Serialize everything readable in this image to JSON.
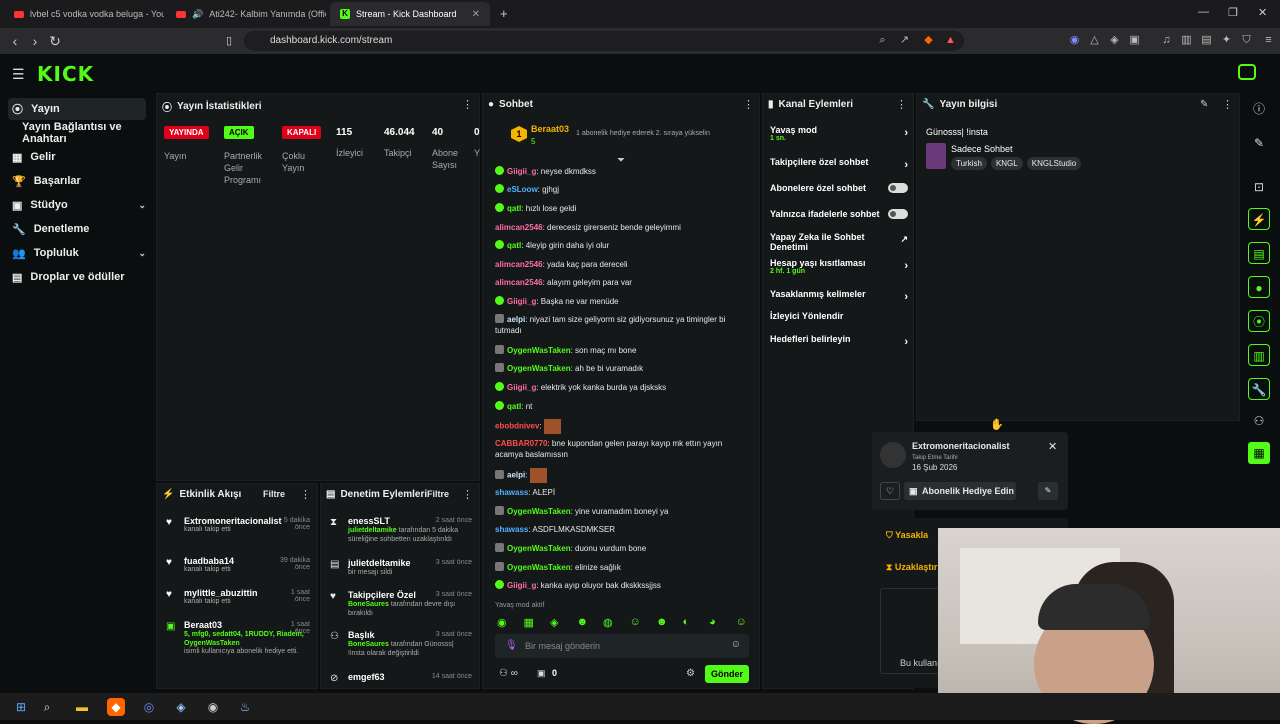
{
  "browser": {
    "tabs": [
      {
        "label": "lvbel c5 vodka vodka beluga - YouTu"
      },
      {
        "label": "Ati242- Kalbim Yanımda (Official"
      },
      {
        "label": "Stream - Kick Dashboard"
      }
    ],
    "url": "dashboard.kick.com/stream"
  },
  "sidebar": {
    "items": [
      {
        "label": "Yayın"
      },
      {
        "label": "Yayın Bağlantısı ve Anahtarı"
      },
      {
        "label": "Gelir"
      },
      {
        "label": "Başarılar"
      },
      {
        "label": "Stüdyo"
      },
      {
        "label": "Denetleme"
      },
      {
        "label": "Topluluk"
      },
      {
        "label": "Droplar ve ödüller"
      }
    ]
  },
  "stats": {
    "title": "Yayın İstatistikleri",
    "badges": [
      "YAYINDA",
      "AÇIK",
      "KAPALI"
    ],
    "badge_labels": [
      "Yayın",
      "Partnerlik Gelir Programı",
      "Çoklu Yayın"
    ],
    "numbers": [
      {
        "value": "115",
        "label": "İzleyici"
      },
      {
        "value": "46.044",
        "label": "Takipçi"
      },
      {
        "value": "40",
        "label": "Abone Sayısı"
      },
      {
        "value": "0",
        "label": "Y"
      }
    ]
  },
  "chat": {
    "title": "Sohbet",
    "pinned_user": "Beraat03",
    "pinned_count": "5",
    "pinned_rank": "1",
    "pinned_text": "1 abonelik hediye ederek 2. sıraya yükselin",
    "messages": [
      {
        "user": "Giigii_g",
        "text": "neyse dkmdkss"
      },
      {
        "user": "eSLoow",
        "text": "gjhgj"
      },
      {
        "user": "qatl",
        "text": "hızlı lose geldi"
      },
      {
        "user": "alimcan2546",
        "text": "derecesiz girerseniz bende geleyimmi"
      },
      {
        "user": "qatl",
        "text": "4leyip girin daha iyi olur"
      },
      {
        "user": "alimcan2546",
        "text": "yada kaç para dereceli"
      },
      {
        "user": "alimcan2546",
        "text": "alayım geleyim para var"
      },
      {
        "user": "Giigii_g",
        "text": "Başka ne var menüde"
      },
      {
        "user": "aelpi",
        "text": "niyazi tam size geliyorm siz gidiyorsunuz ya timingler bi tutmadı"
      },
      {
        "user": "OygenWasTaken",
        "text": "son maç mı bone"
      },
      {
        "user": "OygenWasTaken",
        "text": "ah be bi vuramadık"
      },
      {
        "user": "Giigii_g",
        "text": "elektrik yok kanka burda ya djsksks"
      },
      {
        "user": "qatl",
        "text": "nt"
      },
      {
        "user": "ebobdnivev",
        "text": ""
      },
      {
        "user": "CABBAR0770",
        "text": "bne kupondan gelen parayı kayıp mk ettın yayın acamya baslamıssın"
      },
      {
        "user": "aelpi",
        "text": ""
      },
      {
        "user": "shawass",
        "text": "ALEPİ"
      },
      {
        "user": "OygenWasTaken",
        "text": "yine vuramadım boneyi ya"
      },
      {
        "user": "shawass",
        "text": "ASDFLMKASDMKSER"
      },
      {
        "user": "OygenWasTaken",
        "text": "duonu vurdum bone"
      },
      {
        "user": "OygenWasTaken",
        "text": "elinize sağlık"
      },
      {
        "user": "Giigii_g",
        "text": "kanka ayıp oluyor bak dkskkssjjss"
      }
    ],
    "slow_mode": "Yavaş mod aktif",
    "input_placeholder": "Bir mesaj gönderin",
    "points": "0",
    "send": "Gönder"
  },
  "channel_actions": {
    "title": "Kanal Eylemleri",
    "items": [
      {
        "label": "Yavaş mod",
        "sub": "1 sn."
      },
      {
        "label": "Takipçilere özel sohbet",
        "sub": ""
      },
      {
        "label": "Abonelere özel sohbet",
        "sub": ""
      },
      {
        "label": "Yalnızca ifadelerle sohbet",
        "sub": ""
      },
      {
        "label": "Yapay Zeka ile Sohbet Denetimi",
        "sub": ""
      },
      {
        "label": "Hesap yaşı kısıtlaması",
        "sub": "2 hf. 1 gün"
      },
      {
        "label": "Yasaklanmış kelimeler",
        "sub": ""
      },
      {
        "label": "İzleyici Yönlendir",
        "sub": ""
      },
      {
        "label": "Hedefleri belirleyin",
        "sub": ""
      }
    ]
  },
  "stream_info": {
    "title": "Yayın bilgisi",
    "stream_title": "Günosss| !insta",
    "category": "Sadece Sohbet",
    "tags": [
      "Turkish",
      "KNGL",
      "KNGLStudio"
    ]
  },
  "activity": {
    "title": "Etkinlik Akışı",
    "filter": "Filtre",
    "items": [
      {
        "name": "Extromoneritacionalist",
        "time": "5 dakika önce",
        "sub": "kanalı takip etti"
      },
      {
        "name": "fuadbaba14",
        "time": "39 dakika önce",
        "sub": "kanalı takip etti"
      },
      {
        "name": "mylittle_abuzittin",
        "time": "1 saat önce",
        "sub": "kanalı takip etti"
      },
      {
        "name": "Beraat03",
        "time": "1 saat önce",
        "sub": "isimli kullanıcıya abonelik hediye etti.",
        "extra": "5, mfg0, sedatt04, 1RUDDY, Riadein, OygenWasTaken"
      }
    ]
  },
  "moderation": {
    "title": "Denetim Eylemleri",
    "filter": "Filtre",
    "items": [
      {
        "name": "enessSLT",
        "time": "2 saat önce",
        "actor": "julietdeltamike",
        "sub": "tarafından 5 dakika süreliğine sohbetten uzaklaştırıldı"
      },
      {
        "name": "julietdeltamike",
        "time": "3 saat önce",
        "actor": "",
        "sub": "bir mesajı sildi"
      },
      {
        "name": "Takipçilere Özel",
        "time": "3 saat önce",
        "actor": "BoneSaures",
        "sub": "tarafından devre dışı bırakıldı"
      },
      {
        "name": "Başlık",
        "time": "3 saat önce",
        "actor": "BoneSaures",
        "sub": "tarafından Günosss| !insta olarak değiştirildi"
      },
      {
        "name": "emgef63",
        "time": "14 saat önce",
        "actor": "",
        "sub": ""
      }
    ]
  },
  "user_card": {
    "name": "Extromoneritacionalist",
    "follow_label": "Takip Etme Tarihi",
    "follow_date": "16 Şub 2026",
    "gift": "Abonelik Hediye Edin",
    "ban": "Yasakla",
    "timeout": "Uzaklaştır",
    "footer": "Bu kullanı"
  }
}
